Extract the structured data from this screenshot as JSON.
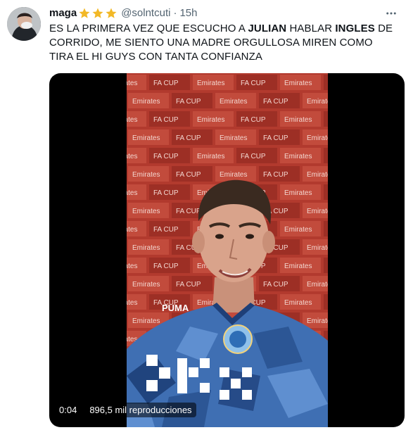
{
  "tweet": {
    "display_name": "maga",
    "handle": "@solntcuti",
    "separator": "·",
    "time": "15h",
    "text_parts": [
      "ES LA PRIMERA VEZ QUE ESCUCHO A ",
      "JULIAN",
      " HABLAR ",
      "INGLES",
      " DE CORRIDO, ME SIENTO UNA MADRE ORGULLOSA MIREN COMO TIRA EL HI GUYS CON TANTA CONFIANZA"
    ],
    "star_count": 3,
    "star_color": "#f2b826"
  },
  "more_menu": {
    "icon": "more-horizontal-icon"
  },
  "video": {
    "time": "0:04",
    "views": "896,5 mil reproducciones",
    "backdrop_text": "Emirates",
    "backdrop_cup": "FA CUP",
    "shirt_brand": "PUMA",
    "shirt_sponsor": "OKX",
    "badge_text": "MANCHESTER CITY"
  },
  "colors": {
    "text_primary": "#0f1419",
    "text_secondary": "#536471",
    "backdrop_red": "#b23a2e"
  }
}
